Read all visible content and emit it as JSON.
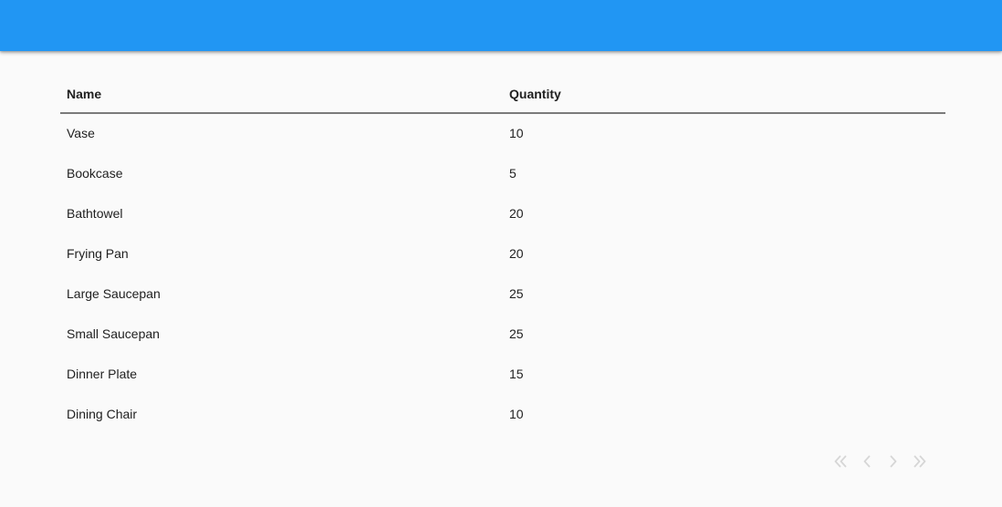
{
  "table": {
    "headers": {
      "name": "Name",
      "quantity": "Quantity"
    },
    "rows": [
      {
        "name": "Vase",
        "quantity": "10"
      },
      {
        "name": "Bookcase",
        "quantity": "5"
      },
      {
        "name": "Bathtowel",
        "quantity": "20"
      },
      {
        "name": "Frying Pan",
        "quantity": "20"
      },
      {
        "name": "Large Saucepan",
        "quantity": "25"
      },
      {
        "name": "Small Saucepan",
        "quantity": "25"
      },
      {
        "name": "Dinner Plate",
        "quantity": "15"
      },
      {
        "name": "Dining Chair",
        "quantity": "10"
      }
    ]
  },
  "pagination": {
    "first_icon": "double-chevron-left-icon",
    "prev_icon": "chevron-left-icon",
    "next_icon": "chevron-right-icon",
    "last_icon": "double-chevron-right-icon",
    "disabled": true
  },
  "colors": {
    "app_bar": "#2196f3",
    "background": "#fafafa",
    "header_divider": "#7a7a7a",
    "pager_icon_disabled": "#d6d6d6"
  }
}
